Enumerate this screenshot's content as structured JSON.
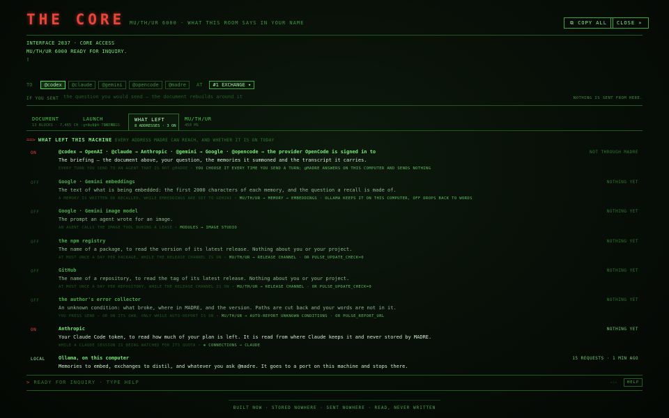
{
  "header": {
    "title": "THE CORE",
    "subtitle": "MU/TH/UR 6000 · WHAT THIS ROOM SAYS IN YOUR NAME",
    "copy_label": "⧉ COPY ALL",
    "close_label": "CLOSE »"
  },
  "boot": {
    "line1": "INTERFACE 2037 · CORE ACCESS",
    "line2": "MU/TH/UR 6000 READY FOR INQUIRY.",
    "cursor": "▯"
  },
  "compose": {
    "to_label": "TO",
    "recipients": [
      "@codex",
      "@claude",
      "@gemini",
      "@opencode",
      "@madre"
    ],
    "at_label": "AT",
    "exchange": "#1 EXCHANGE ▾",
    "if_you_sent_label": "IF YOU SENT",
    "placeholder": "the question you would send — the document rebuilds around it",
    "nothing_sent": "NOTHING IS SENT FROM HERE."
  },
  "tabs": [
    {
      "title": "DOCUMENT",
      "meta": "13 BLOCKS · 7,465 CH · ~2,114 TOKENS"
    },
    {
      "title": "LAUNCH",
      "meta": "groovy · 16 ARGS"
    },
    {
      "title": "WHAT LEFT",
      "meta": "8 ADDRESSES · 3 ON"
    },
    {
      "title": "MU/TH/UR",
      "meta": "450 MS"
    }
  ],
  "section": {
    "arrow": "==>",
    "title": "WHAT LEFT THIS MACHINE",
    "tag": "EVERY ADDRESS MADRE CAN REACH, AND WHETHER IT IS ON TODAY"
  },
  "entries": [
    {
      "status": "ON",
      "name": "@codex → OpenAI · @claude → Anthropic · @gemini → Google · @opencode → the provider OpenCode is signed in to",
      "right": "NOT THROUGH MADRE",
      "desc": "The briefing — the document above, your question, the memories it summoned and the transcript it carries.",
      "note_dim": "EVERY TURN YOU SEND TO AN AGENT THAT IS NOT @MADRE",
      "note_lit": " · YOU CHOOSE IT EVERY TIME YOU SEND A TURN; @MADRE ANSWERS ON THIS COMPUTER AND SENDS NOTHING"
    },
    {
      "status": "OFF",
      "name": "Google · Gemini embeddings",
      "right": "NOTHING YET",
      "desc": "The text of what is being embedded: the first 2000 characters of each memory, and the question a recall is made of.",
      "note_dim": "A MEMORY IS WRITTEN OR RECALLED, WHILE EMBEDDINGS ARE SET TO GEMINI",
      "note_lit": " · MU/TH/UR → MEMORY → EMBEDDINGS · OLLAMA KEEPS IT ON THIS COMPUTER, OFF DROPS BACK TO WORDS"
    },
    {
      "status": "OFF",
      "name": "Google · Gemini image model",
      "right": "NOTHING YET",
      "desc": "The prompt an agent wrote for an image.",
      "note_dim": "AN AGENT CALLS THE IMAGE TOOL DURING A LEASE",
      "note_lit": " · MODULES → IMAGE STUDIO"
    },
    {
      "status": "OFF",
      "name": "the npm registry",
      "right": "NOTHING YET",
      "desc": "The name of a package, to read the version of its latest release. Nothing about you or your project.",
      "note_dim": "AT MOST ONCE A DAY PER PACKAGE, WHILE THE RELEASE CHANNEL IS ON",
      "note_lit": " · MU/TH/UR → RELEASE CHANNEL · OR PULSE_UPDATE_CHECK=0"
    },
    {
      "status": "OFF",
      "name": "GitHub",
      "right": "NOTHING YET",
      "desc": "The name of a repository, to read the tag of its latest release. Nothing about you or your project.",
      "note_dim": "AT MOST ONCE A DAY PER REPOSITORY, WHILE THE RELEASE CHANNEL IS ON",
      "note_lit": " · MU/TH/UR → RELEASE CHANNEL · OR PULSE_UPDATE_CHECK=0"
    },
    {
      "status": "OFF",
      "name": "the author's error collector",
      "right": "NOTHING YET",
      "desc": "An unknown condition: what broke, where in MADRE, and the version. Paths are cut back and your words are not in it.",
      "note_dim": "YOU PRESS SEND — OR ON ITS OWN, ONLY WHILE AUTO-REPORT IS ON",
      "note_lit": " · MU/TH/UR → AUTO-REPORT UNKNOWN CONDITIONS · OR PULSE_REPORT_URL"
    },
    {
      "status": "ON",
      "name": "Anthropic",
      "right": "NOTHING YET",
      "desc": "Your Claude Code token, to read how much of your plan is left. It is read from where Claude keeps it and never stored by MADRE.",
      "note_dim": "WHILE A CLAUDE SESSION IS BEING WATCHED FOR ITS QUOTA",
      "note_lit": " · ⊕ CONNECTIONS → CLAUDE"
    },
    {
      "status": "LOCAL",
      "name": "Ollama, on this computer",
      "right": "15 REQUESTS · 1 MIN AGO",
      "desc": "Memories to embed, exchanges to distil, and whatever you ask @madre. It goes to a port on this machine and stops there.",
      "note_dim": "",
      "note_lit": ""
    }
  ],
  "prompt": {
    "caret": ">",
    "text": "READY FOR INQUIRY · TYPE HELP",
    "dots": "◦◦◦",
    "help_label": "HELP"
  },
  "footer": {
    "text": "BUILT NOW · STORED NOWHERE · SENT NOWHERE · READ, NEVER WRITTEN"
  }
}
